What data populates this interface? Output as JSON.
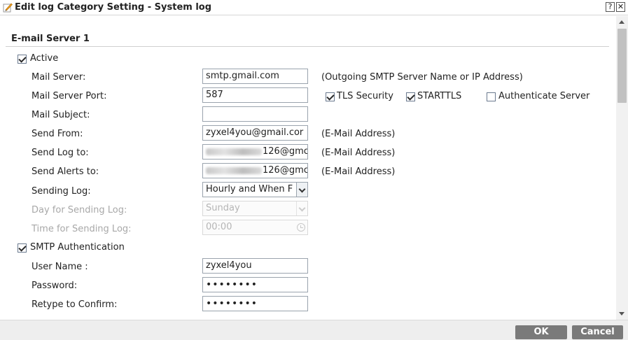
{
  "window": {
    "title": "Edit log Category Setting - System log",
    "help_label": "?",
    "close_label": "✕"
  },
  "section": {
    "title": "E-mail Server 1"
  },
  "active": {
    "label": "Active",
    "checked": true
  },
  "fields": {
    "mail_server": {
      "label": "Mail Server:",
      "value": "smtp.gmail.com",
      "hint": "(Outgoing SMTP Server Name or IP Address)"
    },
    "mail_server_port": {
      "label": "Mail Server Port:",
      "value": "587"
    },
    "mail_subject": {
      "label": "Mail Subject:",
      "value": ""
    },
    "send_from": {
      "label": "Send From:",
      "value": "zyxel4you@gmail.cor",
      "hint": "(E-Mail Address)"
    },
    "send_log_to": {
      "label": "Send Log to:",
      "value_visible": "126@gmc",
      "hint": "(E-Mail Address)"
    },
    "send_alerts_to": {
      "label": "Send Alerts to:",
      "value_visible": "126@gmc",
      "hint": "(E-Mail Address)"
    },
    "sending_log": {
      "label": "Sending Log:",
      "value": "Hourly and When F"
    },
    "day_for_sending_log": {
      "label": "Day for Sending Log:",
      "value": "Sunday"
    },
    "time_for_sending_log": {
      "label": "Time for Sending Log:",
      "value": "00:00"
    }
  },
  "options": {
    "tls_security": {
      "label": "TLS Security",
      "checked": true
    },
    "starttls": {
      "label": "STARTTLS",
      "checked": true
    },
    "authenticate_server": {
      "label": "Authenticate Server",
      "checked": false
    }
  },
  "smtp_auth": {
    "label": "SMTP Authentication",
    "checked": true,
    "user_name": {
      "label": "User Name :",
      "value": "zyxel4you"
    },
    "password": {
      "label": "Password:",
      "value": "••••••••"
    },
    "retype": {
      "label": "Retype to Confirm:",
      "value": "••••••••"
    }
  },
  "buttons": {
    "ok": "OK",
    "cancel": "Cancel"
  }
}
